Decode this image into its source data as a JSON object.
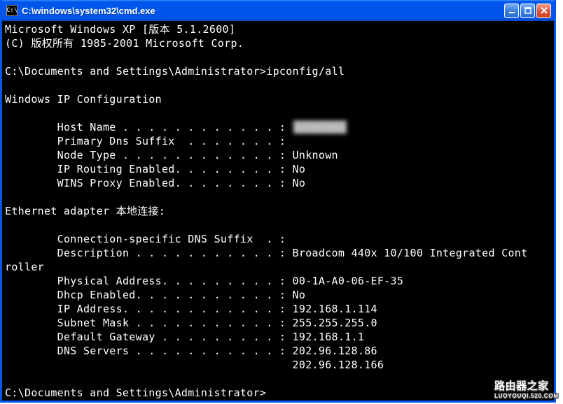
{
  "window": {
    "title": "C:\\windows\\system32\\cmd.exe",
    "icon_label": "C:\\"
  },
  "terminal": {
    "header_line1": "Microsoft Windows XP [版本 5.1.2600]",
    "header_line2": "(C) 版权所有 1985-2001 Microsoft Corp.",
    "prompt1_path": "C:\\Documents and Settings\\Administrator>",
    "prompt1_cmd": "ipconfig/all",
    "section_winip": "Windows IP Configuration",
    "host_name_label": "        Host Name . . . . . . . . . . . . : ",
    "host_name_value": "████████",
    "primary_dns_suffix": "        Primary Dns Suffix  . . . . . . . :",
    "node_type": "        Node Type . . . . . . . . . . . . : Unknown",
    "ip_routing": "        IP Routing Enabled. . . . . . . . : No",
    "wins_proxy": "        WINS Proxy Enabled. . . . . . . . : No",
    "section_ethernet": "Ethernet adapter 本地连接:",
    "conn_dns_suffix": "        Connection-specific DNS Suffix  . :",
    "description_line": "        Description . . . . . . . . . . . : Broadcom 440x 10/100 Integrated Cont",
    "description_wrap": "roller",
    "physical_address": "        Physical Address. . . . . . . . . : 00-1A-A0-06-EF-35",
    "dhcp_enabled": "        Dhcp Enabled. . . . . . . . . . . : No",
    "ip_address": "        IP Address. . . . . . . . . . . . : 192.168.1.114",
    "subnet_mask": "        Subnet Mask . . . . . . . . . . . : 255.255.255.0",
    "default_gateway": "        Default Gateway . . . . . . . . . : 192.168.1.1",
    "dns_servers": "        DNS Servers . . . . . . . . . . . : 202.96.128.86",
    "dns_servers2": "                                            202.96.128.166",
    "prompt2": "C:\\Documents and Settings\\Administrator>"
  },
  "watermark": {
    "main": "路由器之家",
    "sub": "LUOYOUQI.520.COM"
  }
}
